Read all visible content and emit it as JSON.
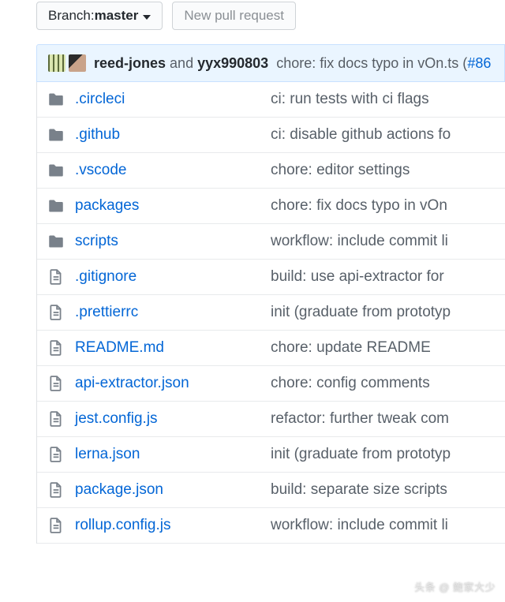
{
  "toolbar": {
    "branch_prefix": "Branch: ",
    "branch_name": "master",
    "new_pr_label": "New pull request"
  },
  "commit_bar": {
    "author1": "reed-jones",
    "sep": " and ",
    "author2": "yyx990803",
    "message": "chore: fix docs typo in vOn.ts (",
    "pr_ref": "#86"
  },
  "files": [
    {
      "type": "folder",
      "name": ".circleci",
      "msg": "ci: run tests with ci flags"
    },
    {
      "type": "folder",
      "name": ".github",
      "msg": "ci: disable github actions fo"
    },
    {
      "type": "folder",
      "name": ".vscode",
      "msg": "chore: editor settings"
    },
    {
      "type": "folder",
      "name": "packages",
      "msg": "chore: fix docs typo in vOn"
    },
    {
      "type": "folder",
      "name": "scripts",
      "msg": "workflow: include commit li"
    },
    {
      "type": "file",
      "name": ".gitignore",
      "msg": "build: use api-extractor for"
    },
    {
      "type": "file",
      "name": ".prettierrc",
      "msg": "init (graduate from prototyp"
    },
    {
      "type": "file",
      "name": "README.md",
      "msg": "chore: update README"
    },
    {
      "type": "file",
      "name": "api-extractor.json",
      "msg": "chore: config comments"
    },
    {
      "type": "file",
      "name": "jest.config.js",
      "msg": "refactor: further tweak com"
    },
    {
      "type": "file",
      "name": "lerna.json",
      "msg": "init (graduate from prototyp"
    },
    {
      "type": "file",
      "name": "package.json",
      "msg": "build: separate size scripts"
    },
    {
      "type": "file",
      "name": "rollup.config.js",
      "msg": "workflow: include commit li"
    }
  ],
  "watermark": "头条 @ 鲍家大少"
}
